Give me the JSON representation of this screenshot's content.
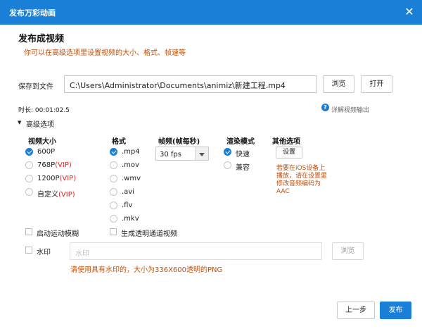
{
  "window": {
    "title": "发布万彩动画",
    "close_icon": "close-icon"
  },
  "section": {
    "title": "发布成视频",
    "hint": "你可以在高级选项里设置视频的大小、格式、帧速等"
  },
  "save": {
    "label": "保存到文件",
    "path": "C:\\Users\\Administrator\\Documents\\animiz\\新建工程.mp4",
    "browse": "浏览",
    "open": "打开"
  },
  "duration": {
    "text": "时长: 00:01:02.5"
  },
  "help_link": {
    "text": "详解视频输出"
  },
  "advanced": {
    "label": "高级选项"
  },
  "video_size": {
    "header": "视频大小",
    "options": [
      {
        "label": "600P",
        "vip": "",
        "checked": true
      },
      {
        "label": "768P",
        "vip": "(VIP)",
        "checked": false
      },
      {
        "label": "1200P",
        "vip": "(VIP)",
        "checked": false
      },
      {
        "label": "自定义",
        "vip": "(VIP)",
        "checked": false
      }
    ]
  },
  "format": {
    "header": "格式",
    "options": [
      {
        "label": ".mp4",
        "checked": true
      },
      {
        "label": ".mov",
        "checked": false
      },
      {
        "label": ".wmv",
        "checked": false
      },
      {
        "label": ".avi",
        "checked": false
      },
      {
        "label": ".flv",
        "checked": false
      },
      {
        "label": ".mkv",
        "checked": false
      }
    ]
  },
  "framerate": {
    "header": "帧频(帧每秒)",
    "value": "30 fps"
  },
  "render": {
    "header": "渲染模式",
    "options": [
      {
        "label": "快速",
        "checked": true
      },
      {
        "label": "兼容",
        "checked": false
      }
    ]
  },
  "other": {
    "header": "其他选项",
    "settings_button": "设置",
    "ios_note": [
      "若要在iOS设备上",
      "播放，请在设置里",
      "修改音频编码为",
      "AAC"
    ]
  },
  "motion_blur": {
    "label": "启动运动模糊",
    "checked": false
  },
  "alpha_video": {
    "label": "生成透明通道视频",
    "checked": false
  },
  "watermark": {
    "label": "水印",
    "placeholder": "水印",
    "browse": "浏览",
    "hint": "请使用具有水印的，大小为336X600透明的PNG",
    "checked": false
  },
  "footer": {
    "prev": "上一步",
    "publish": "发布"
  },
  "colors": {
    "accent": "#1a7fd6",
    "orange": "#c0510e",
    "vip": "#e0221e"
  }
}
